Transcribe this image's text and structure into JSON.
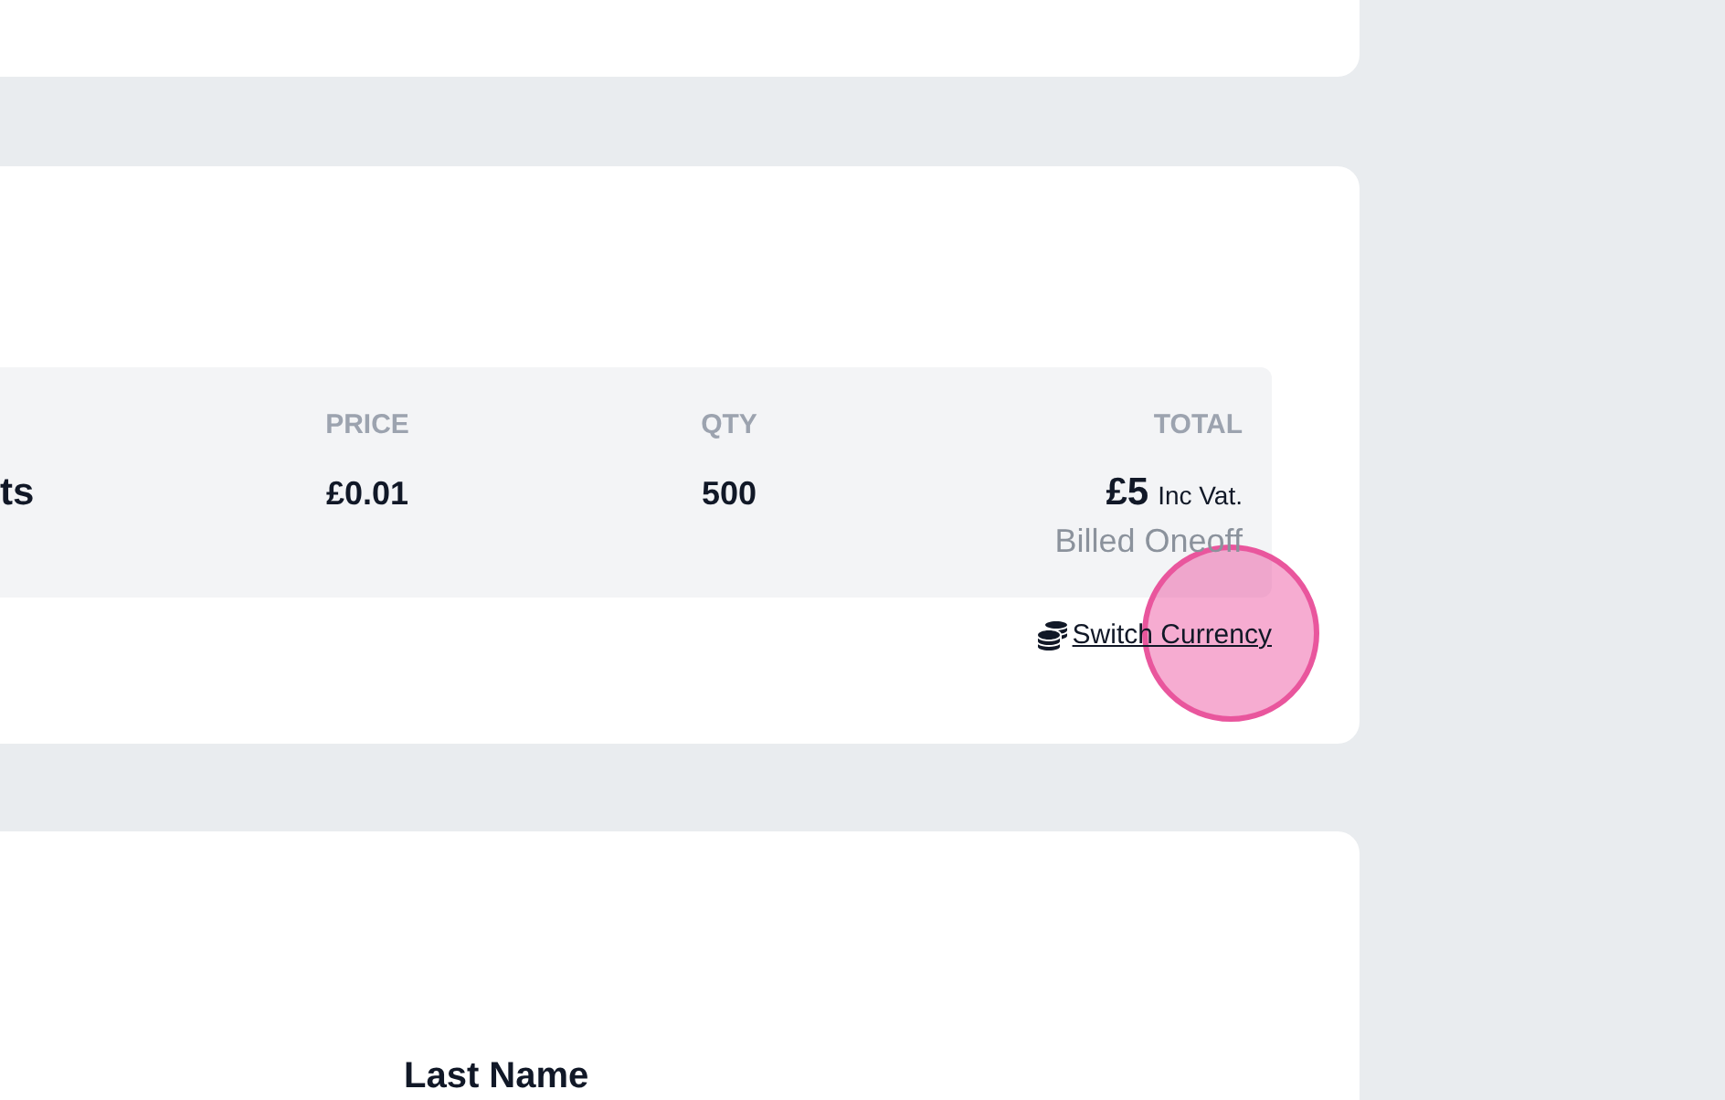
{
  "order_card": {
    "table": {
      "columns": [
        {
          "label": "PRICE"
        },
        {
          "label": "QTY"
        },
        {
          "label": "TOTAL"
        }
      ],
      "row": {
        "product": "ts",
        "price": "£0.01",
        "qty": "500",
        "total": "£5",
        "total_note": "Inc Vat.",
        "billing": "Billed Oneoff"
      }
    },
    "switch_currency_link": "Switch Currency"
  },
  "details_card": {
    "field_label": "Last Name"
  }
}
